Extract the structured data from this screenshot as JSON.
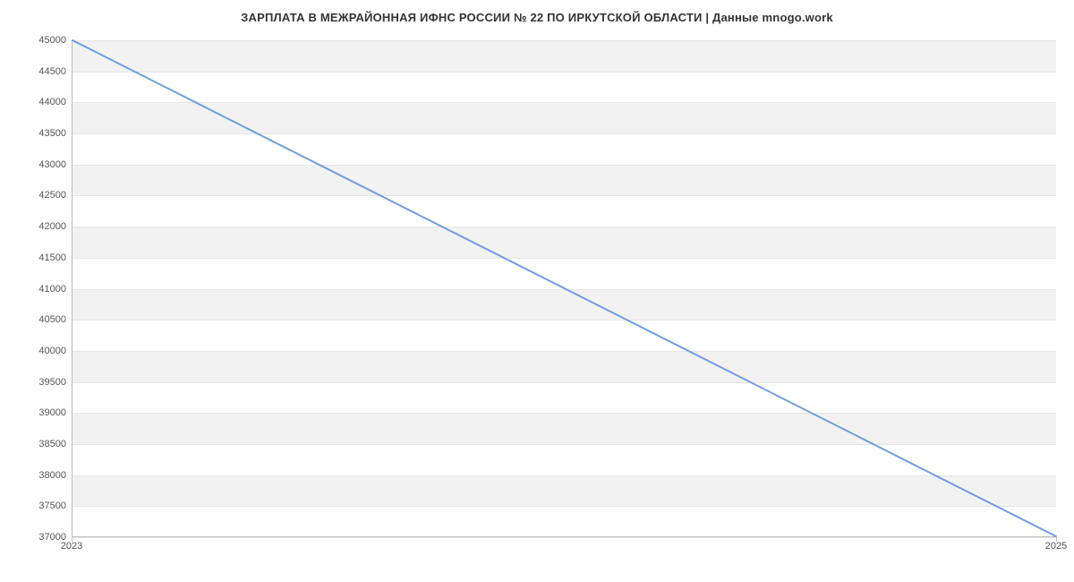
{
  "chart_data": {
    "type": "line",
    "title": "ЗАРПЛАТА В МЕЖРАЙОННАЯ ИФНС РОССИИ № 22 ПО ИРКУТСКОЙ ОБЛАСТИ | Данные mnogo.work",
    "xlabel": "",
    "ylabel": "",
    "x": [
      2023,
      2025
    ],
    "values": [
      45000,
      37000
    ],
    "xlim": [
      2023,
      2025
    ],
    "ylim": [
      37000,
      45000
    ],
    "x_ticks": [
      2023,
      2025
    ],
    "y_ticks": [
      37000,
      37500,
      38000,
      38500,
      39000,
      39500,
      40000,
      40500,
      41000,
      41500,
      42000,
      42500,
      43000,
      43500,
      44000,
      44500,
      45000
    ],
    "line_color": "#6d9fe0",
    "band_color": "#f2f2f2",
    "grid": true
  }
}
